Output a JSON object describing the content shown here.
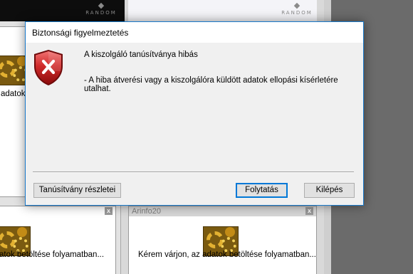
{
  "dialog": {
    "title": "Biztonsági figyelmeztetés",
    "heading": "A kiszolgáló tanúsítványa hibás",
    "detail": "- A hiba átverési vagy a kiszolgálóra küldött adatok ellopási kísérletére utalhat.",
    "icon": "security-warning-shield-icon",
    "buttons": {
      "details": "Tanúsítvány részletei",
      "continue": "Folytatás",
      "exit": "Kilépés"
    }
  },
  "background": {
    "logo_text": "RANDOM",
    "tile_close": "x",
    "tile_top_left_text": "adatok b",
    "tile_title": "Arinfo20",
    "tile_bottom_left_text": "atok betöltése folyamatban...",
    "tile_bottom_mid_text": "Kérem várjon, az adatok betöltése folyamatban..."
  },
  "colors": {
    "accent": "#0078d7",
    "dialog_border": "#1979ca",
    "shield_red": "#c8272a"
  }
}
